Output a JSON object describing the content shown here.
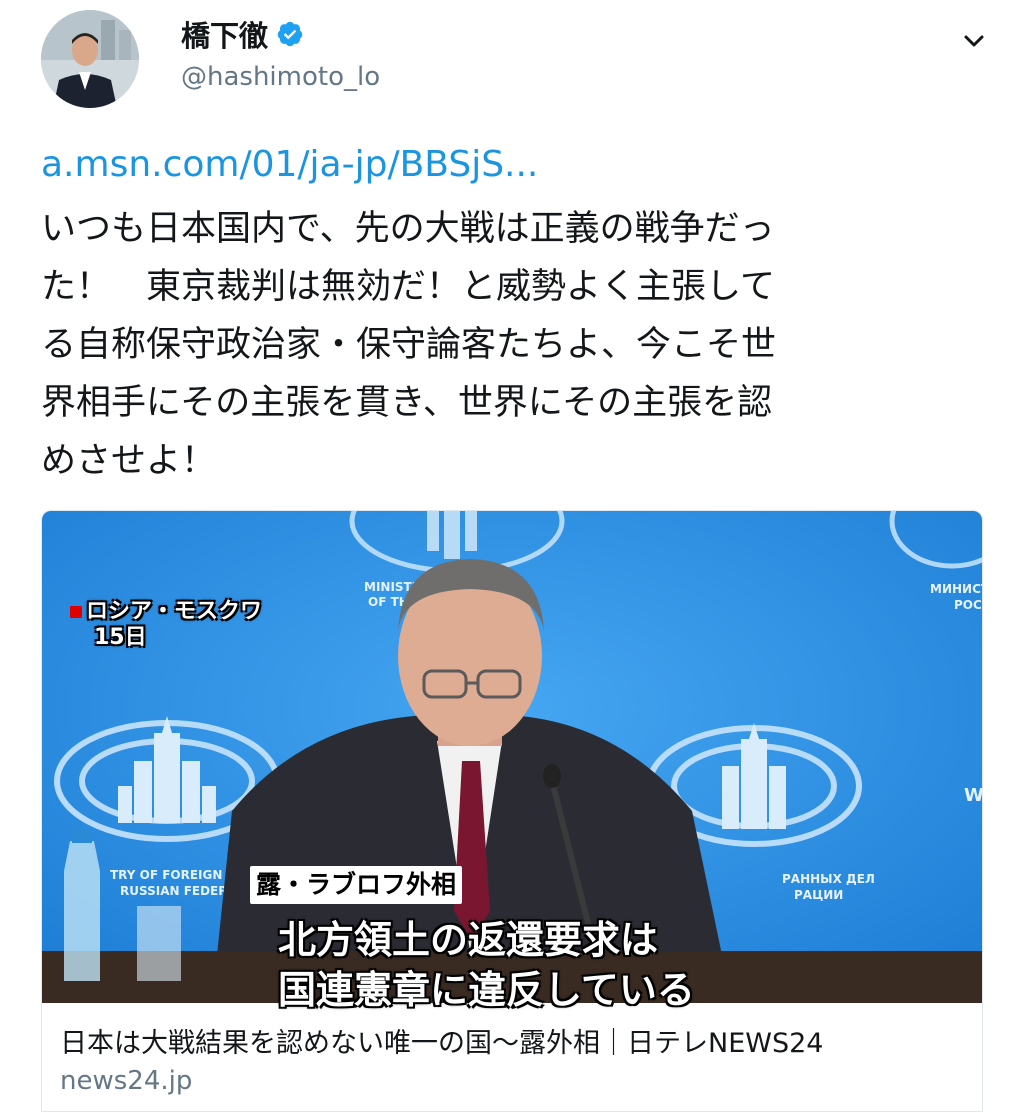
{
  "user": {
    "display_name": "橋下徹",
    "handle": "@hashimoto_lo"
  },
  "tweet": {
    "link_text": "a.msn.com/01/ja-jp/BBSjS...",
    "text": "いつも日本国内で、先の大戦は正義の戦争だっ\nた！　東京裁判は無効だ！と威勢よく主張して\nる自称保守政治家・保守論客たちよ、今こそ世\n界相手にその主張を貫き、世界にその主張を認\nめさせよ！"
  },
  "card": {
    "image_captions": {
      "location": "ロシア・モスクワ",
      "date": "15日",
      "speaker": "露・ラブロフ外相",
      "subtitle_line1": "北方領土の返還要求は",
      "subtitle_line2": "国連憲章に違反している",
      "backdrop_left_top": "MINISTRY OF",
      "backdrop_left_top2": "OF THE R",
      "backdrop_left_bottom": "TRY OF FOREIGN AFF",
      "backdrop_left_bottom2": "RUSSIAN FEDER",
      "backdrop_right_top": "МИНИСТ",
      "backdrop_right_top2": "РОС",
      "backdrop_right_bottom": "РАННЫХ ДЕЛ",
      "backdrop_right_bottom2": "РАЦИИ",
      "backdrop_right_edge": "W"
    },
    "title": "日本は大戦結果を認めない唯一の国～露外相｜日テレNEWS24",
    "domain": "news24.jp"
  },
  "colors": {
    "link": "#1b95e0",
    "verified": "#1da1f2",
    "backdrop_blue": "#2e8fe0"
  },
  "icons": [
    "verified-badge-icon",
    "chevron-down-icon"
  ]
}
